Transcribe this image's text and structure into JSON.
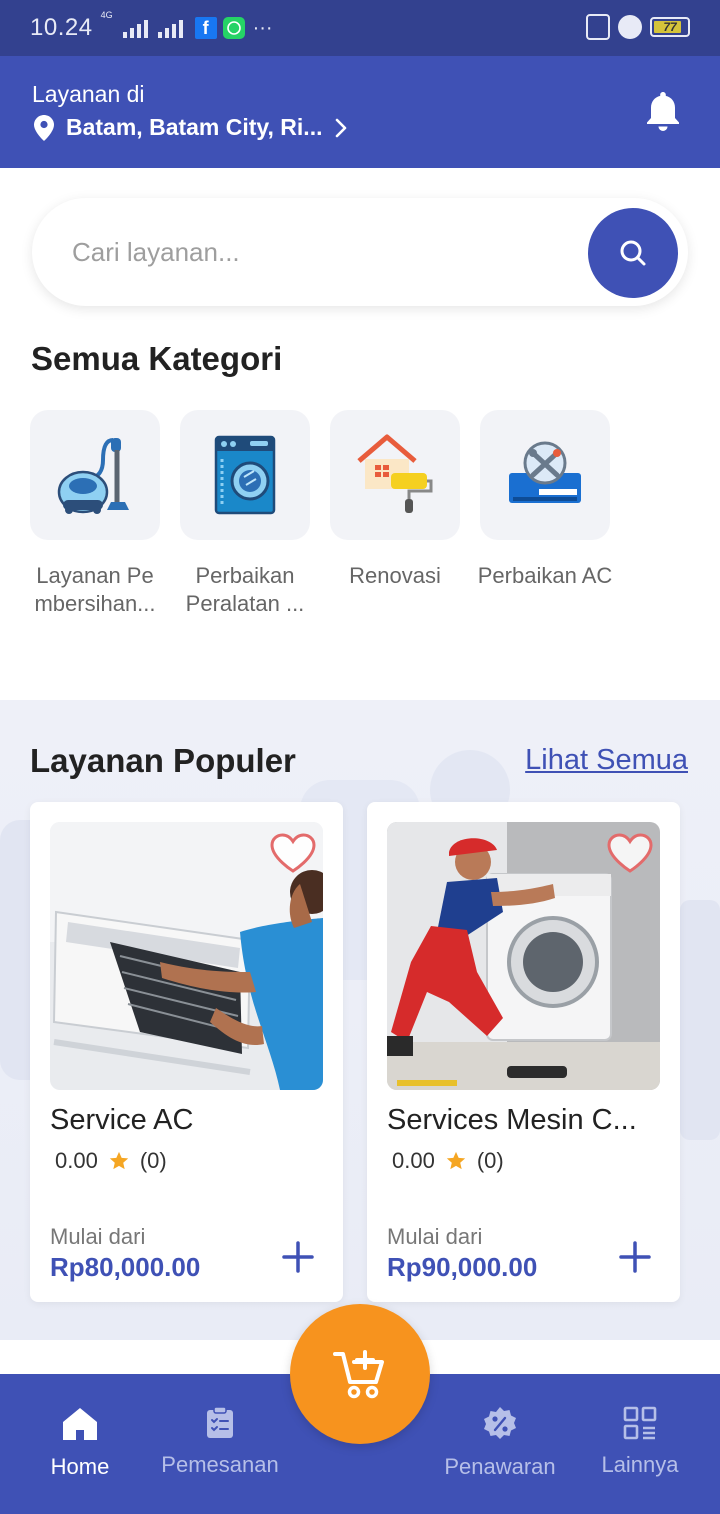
{
  "status_bar": {
    "time": "10.24",
    "network": "4G",
    "battery": "77"
  },
  "header": {
    "service_label": "Layanan di",
    "location": "Batam, Batam City, Ri..."
  },
  "search": {
    "placeholder": "Cari layanan..."
  },
  "categories": {
    "title": "Semua Kategori",
    "items": [
      {
        "label": "Layanan Pe mbersihan...",
        "icon": "vacuum-cleaner-icon"
      },
      {
        "label": "Perbaikan Peralatan ...",
        "icon": "washing-machine-icon"
      },
      {
        "label": "Renovasi",
        "icon": "house-paint-roller-icon"
      },
      {
        "label": "Perbaikan AC",
        "icon": "ac-repair-icon"
      }
    ]
  },
  "popular": {
    "title": "Layanan Populer",
    "see_all": "Lihat Semua",
    "cards": [
      {
        "name": "Service AC",
        "rating": "0.00",
        "reviews": "(0)",
        "from_label": "Mulai dari",
        "price": "Rp80,000.00",
        "image": "ac-technician-photo"
      },
      {
        "name": "Services Mesin C...",
        "rating": "0.00",
        "reviews": "(0)",
        "from_label": "Mulai dari",
        "price": "Rp90,000.00",
        "image": "washing-machine-technician-photo"
      }
    ]
  },
  "bottom_nav": {
    "items": [
      {
        "label": "Home",
        "icon": "home-icon",
        "active": true
      },
      {
        "label": "Pemesanan",
        "icon": "clipboard-icon",
        "active": false
      },
      {
        "label": "Penawaran",
        "icon": "discount-badge-icon",
        "active": false
      },
      {
        "label": "Lainnya",
        "icon": "grid-icon",
        "active": false
      }
    ],
    "cart_icon": "cart-add-icon"
  },
  "colors": {
    "primary": "#3f51b5",
    "status_bar": "#33418f",
    "accent": "#f7931e",
    "star": "#f5a623"
  }
}
